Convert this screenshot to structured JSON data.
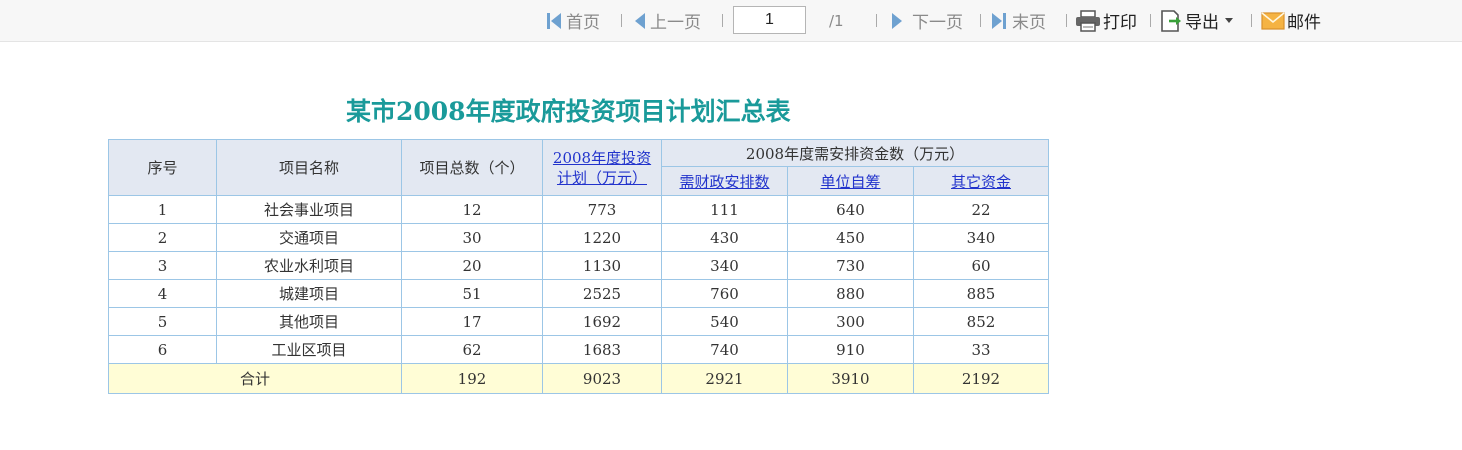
{
  "toolbar": {
    "first": "首页",
    "prev": "上一页",
    "page_value": "1",
    "total_pages": "/1",
    "next": "下一页",
    "last": "末页",
    "print": "打印",
    "export": "导出",
    "mail": "邮件"
  },
  "report": {
    "title": "某市2008年度政府投资项目计划汇总表",
    "headers": {
      "seq": "序号",
      "name": "项目名称",
      "count": "项目总数（个）",
      "plan_line1": "2008年度投资",
      "plan_line2": "计划（万元）",
      "funds_group": "2008年度需安排资金数（万元）",
      "fiscal": "需财政安排数",
      "self": "单位自筹",
      "other": "其它资金"
    },
    "rows": [
      {
        "seq": "1",
        "name": "社会事业项目",
        "count": "12",
        "plan": "773",
        "fiscal": "111",
        "self": "640",
        "other": "22"
      },
      {
        "seq": "2",
        "name": "交通项目",
        "count": "30",
        "plan": "1220",
        "fiscal": "430",
        "self": "450",
        "other": "340"
      },
      {
        "seq": "3",
        "name": "农业水利项目",
        "count": "20",
        "plan": "1130",
        "fiscal": "340",
        "self": "730",
        "other": "60"
      },
      {
        "seq": "4",
        "name": "城建项目",
        "count": "51",
        "plan": "2525",
        "fiscal": "760",
        "self": "880",
        "other": "885"
      },
      {
        "seq": "5",
        "name": "其他项目",
        "count": "17",
        "plan": "1692",
        "fiscal": "540",
        "self": "300",
        "other": "852"
      },
      {
        "seq": "6",
        "name": "工业区项目",
        "count": "62",
        "plan": "1683",
        "fiscal": "740",
        "self": "910",
        "other": "33"
      }
    ],
    "total": {
      "label": "合计",
      "count": "192",
      "plan": "9023",
      "fiscal": "2921",
      "self": "3910",
      "other": "2192"
    }
  }
}
